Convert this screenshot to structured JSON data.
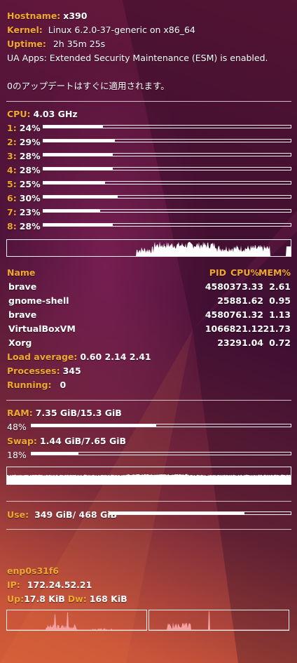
{
  "system": {
    "hostname_label": "Hostname:",
    "hostname": "x390",
    "kernel_label": "Kernel:",
    "kernel": "Linux 6.2.0-37-generic on x86_64",
    "uptime_label": "Uptime:",
    "uptime": "2h 35m 25s",
    "ua_apps": "UA Apps: Extended Security Maintenance (ESM) is enabled.",
    "updates": "0のアップデートはすぐに適用されます。"
  },
  "cpu": {
    "label": "CPU:",
    "freq": "4.03 GHz",
    "cores": [
      {
        "id": "1:",
        "pct_text": "24%",
        "pct": 24
      },
      {
        "id": "2:",
        "pct_text": "29%",
        "pct": 29
      },
      {
        "id": "3:",
        "pct_text": "28%",
        "pct": 28
      },
      {
        "id": "4:",
        "pct_text": "28%",
        "pct": 28
      },
      {
        "id": "5:",
        "pct_text": "25%",
        "pct": 25
      },
      {
        "id": "6:",
        "pct_text": "30%",
        "pct": 30
      },
      {
        "id": "7:",
        "pct_text": "23%",
        "pct": 23
      },
      {
        "id": "8:",
        "pct_text": "28%",
        "pct": 28
      }
    ]
  },
  "processes": {
    "headers": {
      "name": "Name",
      "pid": "PID",
      "cpu": "CPU%",
      "mem": "MEM%"
    },
    "rows": [
      {
        "name": "brave",
        "pid": "458037",
        "cpu": "3.33",
        "mem": "2.61"
      },
      {
        "name": "gnome-shell",
        "pid": "2588",
        "cpu": "1.62",
        "mem": "0.95"
      },
      {
        "name": "brave",
        "pid": "458076",
        "cpu": "1.32",
        "mem": "1.13"
      },
      {
        "name": "VirtualBoxVM",
        "pid": "106682",
        "cpu": "1.12",
        "mem": "21.73"
      },
      {
        "name": "Xorg",
        "pid": "2329",
        "cpu": "1.04",
        "mem": "0.72"
      }
    ],
    "load_label": "Load average:",
    "load": "0.60 2.14 2.41",
    "processes_label": "Processes:",
    "processes": "345",
    "running_label": "Running:",
    "running": "0"
  },
  "memory": {
    "ram_label": "RAM:",
    "ram": "7.35 GiB/15.3 GiB",
    "ram_pct_text": "48%",
    "ram_pct": 48,
    "swap_label": "Swap:",
    "swap": "1.44 GiB/7.65 GiB",
    "swap_pct_text": "18%",
    "swap_pct": 18
  },
  "disk": {
    "label": "Use:",
    "value": "349 GiB/ 468 GiB",
    "pct": 74.6
  },
  "network": {
    "interface": "enp0s31f6",
    "ip_label": "IP:",
    "ip": "172.24.52.21",
    "up_label": "Up:",
    "up": "17.8 KiB",
    "down_label": "Dw:",
    "down": "168 KiB"
  },
  "colors": {
    "label": "#f0a830",
    "text": "#ffffff",
    "graph_net": "#f4a0a0"
  }
}
